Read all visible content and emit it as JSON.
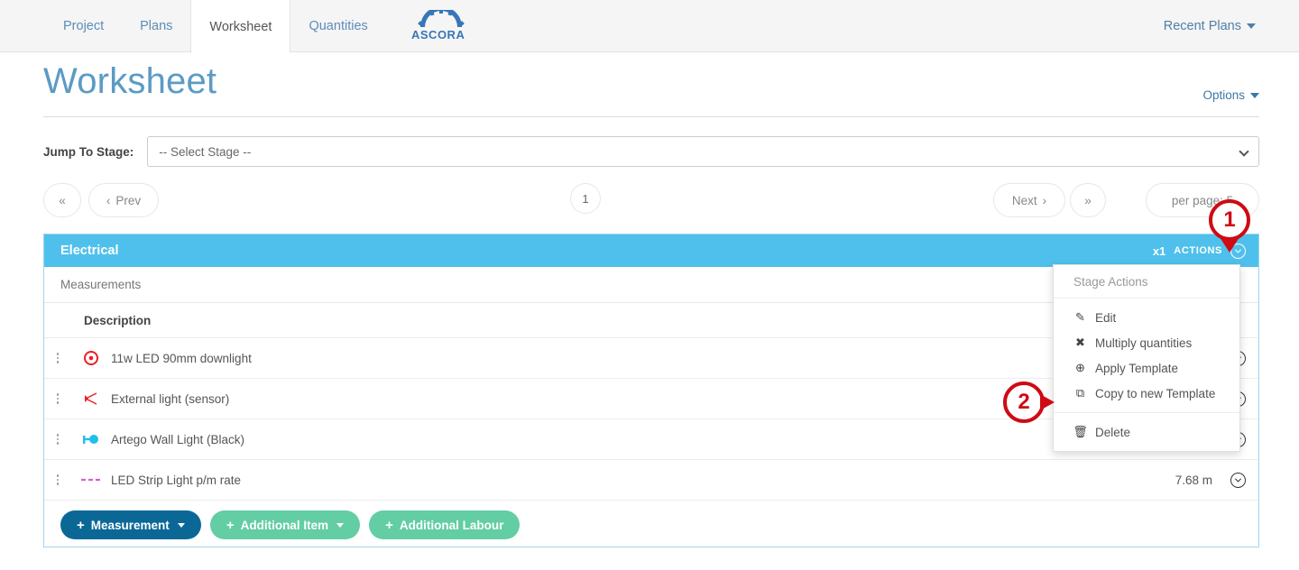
{
  "nav": {
    "tabs": [
      {
        "label": "Project",
        "active": false
      },
      {
        "label": "Plans",
        "active": false
      },
      {
        "label": "Worksheet",
        "active": true
      },
      {
        "label": "Quantities",
        "active": false
      }
    ],
    "logo_text": "ASCORA",
    "recent_plans_label": "Recent Plans"
  },
  "header": {
    "title": "Worksheet",
    "options_label": "Options"
  },
  "jump_to_stage": {
    "label": "Jump To Stage:",
    "selected": "-- Select Stage --"
  },
  "pager": {
    "first_label": "«",
    "prev_label": "Prev",
    "current_page": "1",
    "next_label": "Next",
    "last_label": "»",
    "per_page_label": "per page: 5"
  },
  "stage": {
    "name": "Electrical",
    "quantity_badge": "x1",
    "actions_label": "ACTIONS",
    "measurements_label": "Measurements",
    "description_header": "Description"
  },
  "rows": [
    {
      "description": "11w LED 90mm downlight",
      "quantity": "",
      "icon": "circle-dot-icon",
      "icon_color": "#ee1c24"
    },
    {
      "description": "External light (sensor)",
      "quantity": "",
      "icon": "sensor-arrow-icon",
      "icon_color": "#ee1c24"
    },
    {
      "description": "Artego Wall Light (Black)",
      "quantity": "",
      "icon": "line-dot-icon",
      "icon_color": "#1fbfec"
    },
    {
      "description": "LED Strip Light p/m rate",
      "quantity": "7.68 m",
      "icon": "dashed-line-icon",
      "icon_color": "#d95fd0"
    }
  ],
  "footer_buttons": [
    {
      "label": "Measurement",
      "has_caret": true,
      "style": "primary"
    },
    {
      "label": "Additional Item",
      "has_caret": true,
      "style": "green"
    },
    {
      "label": "Additional Labour",
      "has_caret": false,
      "style": "green"
    }
  ],
  "dropdown": {
    "title": "Stage Actions",
    "items": [
      {
        "label": "Edit",
        "icon": "edit-pencil-icon",
        "glyph": "✎"
      },
      {
        "label": "Multiply quantities",
        "icon": "multiply-x-icon",
        "glyph": "✖"
      },
      {
        "label": "Apply Template",
        "icon": "apply-template-icon",
        "glyph": "⊕"
      },
      {
        "label": "Copy to new Template",
        "icon": "copy-icon",
        "glyph": "⧉"
      }
    ],
    "delete": {
      "label": "Delete",
      "icon": "trash-icon",
      "glyph": "🗑"
    }
  },
  "annotations": [
    {
      "number": "1",
      "points": "down"
    },
    {
      "number": "2",
      "points": "right"
    }
  ],
  "colors": {
    "stage_header": "#4fc0ec",
    "primary_button": "#0b6896",
    "green_button": "#63cda3",
    "marker_red": "#cf0a15",
    "title_blue": "#5b9bc4"
  }
}
